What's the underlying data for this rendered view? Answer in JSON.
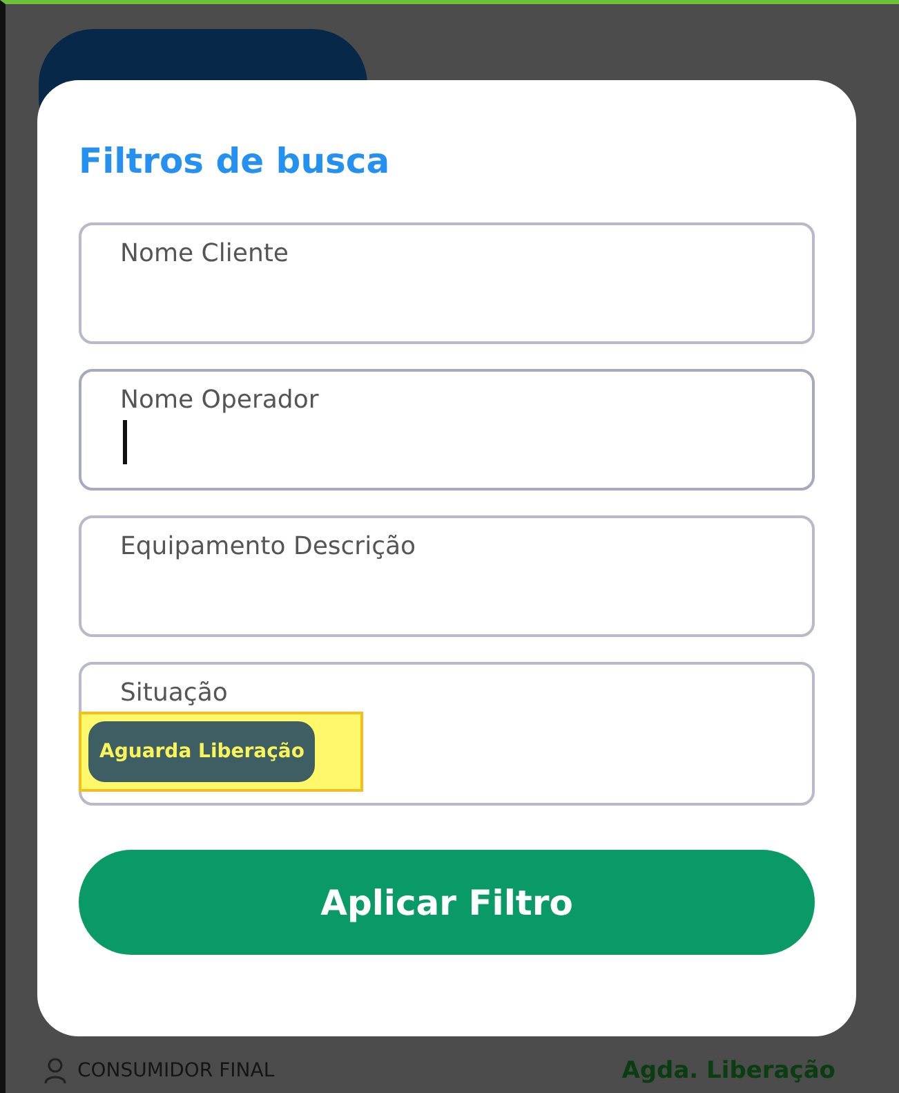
{
  "background": {
    "bottom_row": {
      "client": "CONSUMIDOR FINAL",
      "status": "Agda. Liberação"
    }
  },
  "modal": {
    "title": "Filtros de busca",
    "fields": [
      {
        "label": "Nome Cliente",
        "focused": false
      },
      {
        "label": "Nome Operador",
        "focused": true
      },
      {
        "label": "Equipamento Descrição",
        "focused": false
      },
      {
        "label": "Situação",
        "focused": false,
        "chip": "Aguarda Liberação"
      }
    ],
    "apply_button": "Aplicar Filtro"
  }
}
